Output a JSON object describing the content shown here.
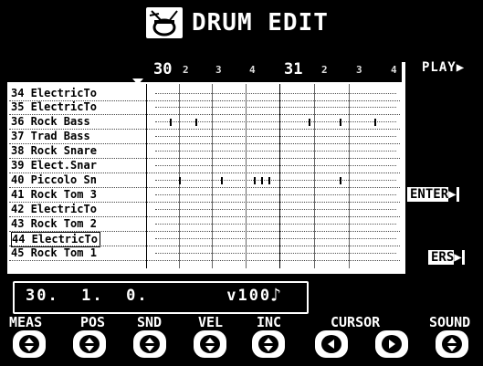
{
  "header": {
    "title": "DRUM EDIT",
    "icon": "drum-kit-icon"
  },
  "grid": {
    "measures": [
      "30",
      "31"
    ],
    "beat_labels": [
      "2",
      "3",
      "4",
      "2",
      "3",
      "4"
    ],
    "rows": [
      {
        "label": "34 ElectricTo",
        "selected": false
      },
      {
        "label": "35 ElectricTo",
        "selected": false
      },
      {
        "label": "36 Rock Bass",
        "selected": false
      },
      {
        "label": "37 Trad Bass",
        "selected": false
      },
      {
        "label": "38 Rock Snare",
        "selected": false
      },
      {
        "label": "39 Elect.Snar",
        "selected": false
      },
      {
        "label": "40 Piccolo Sn",
        "selected": false
      },
      {
        "label": "41 Rock Tom 3",
        "selected": false
      },
      {
        "label": "42 ElectricTo",
        "selected": false
      },
      {
        "label": "43 Rock Tom 2",
        "selected": false
      },
      {
        "label": "44 ElectricTo",
        "selected": true
      },
      {
        "label": "45 Rock Tom 1",
        "selected": false
      }
    ]
  },
  "side_buttons": {
    "play": "PLAY",
    "enter": "ENTER",
    "ers": "ERS"
  },
  "status": {
    "text": "30.  1.  0.       v100",
    "note_glyph": "♪"
  },
  "controls": {
    "meas": "MEAS",
    "pos": "POS",
    "snd": "SND",
    "vel": "VEL",
    "inc": "INC",
    "cursor": "CURSOR",
    "sound": "SOUND"
  }
}
